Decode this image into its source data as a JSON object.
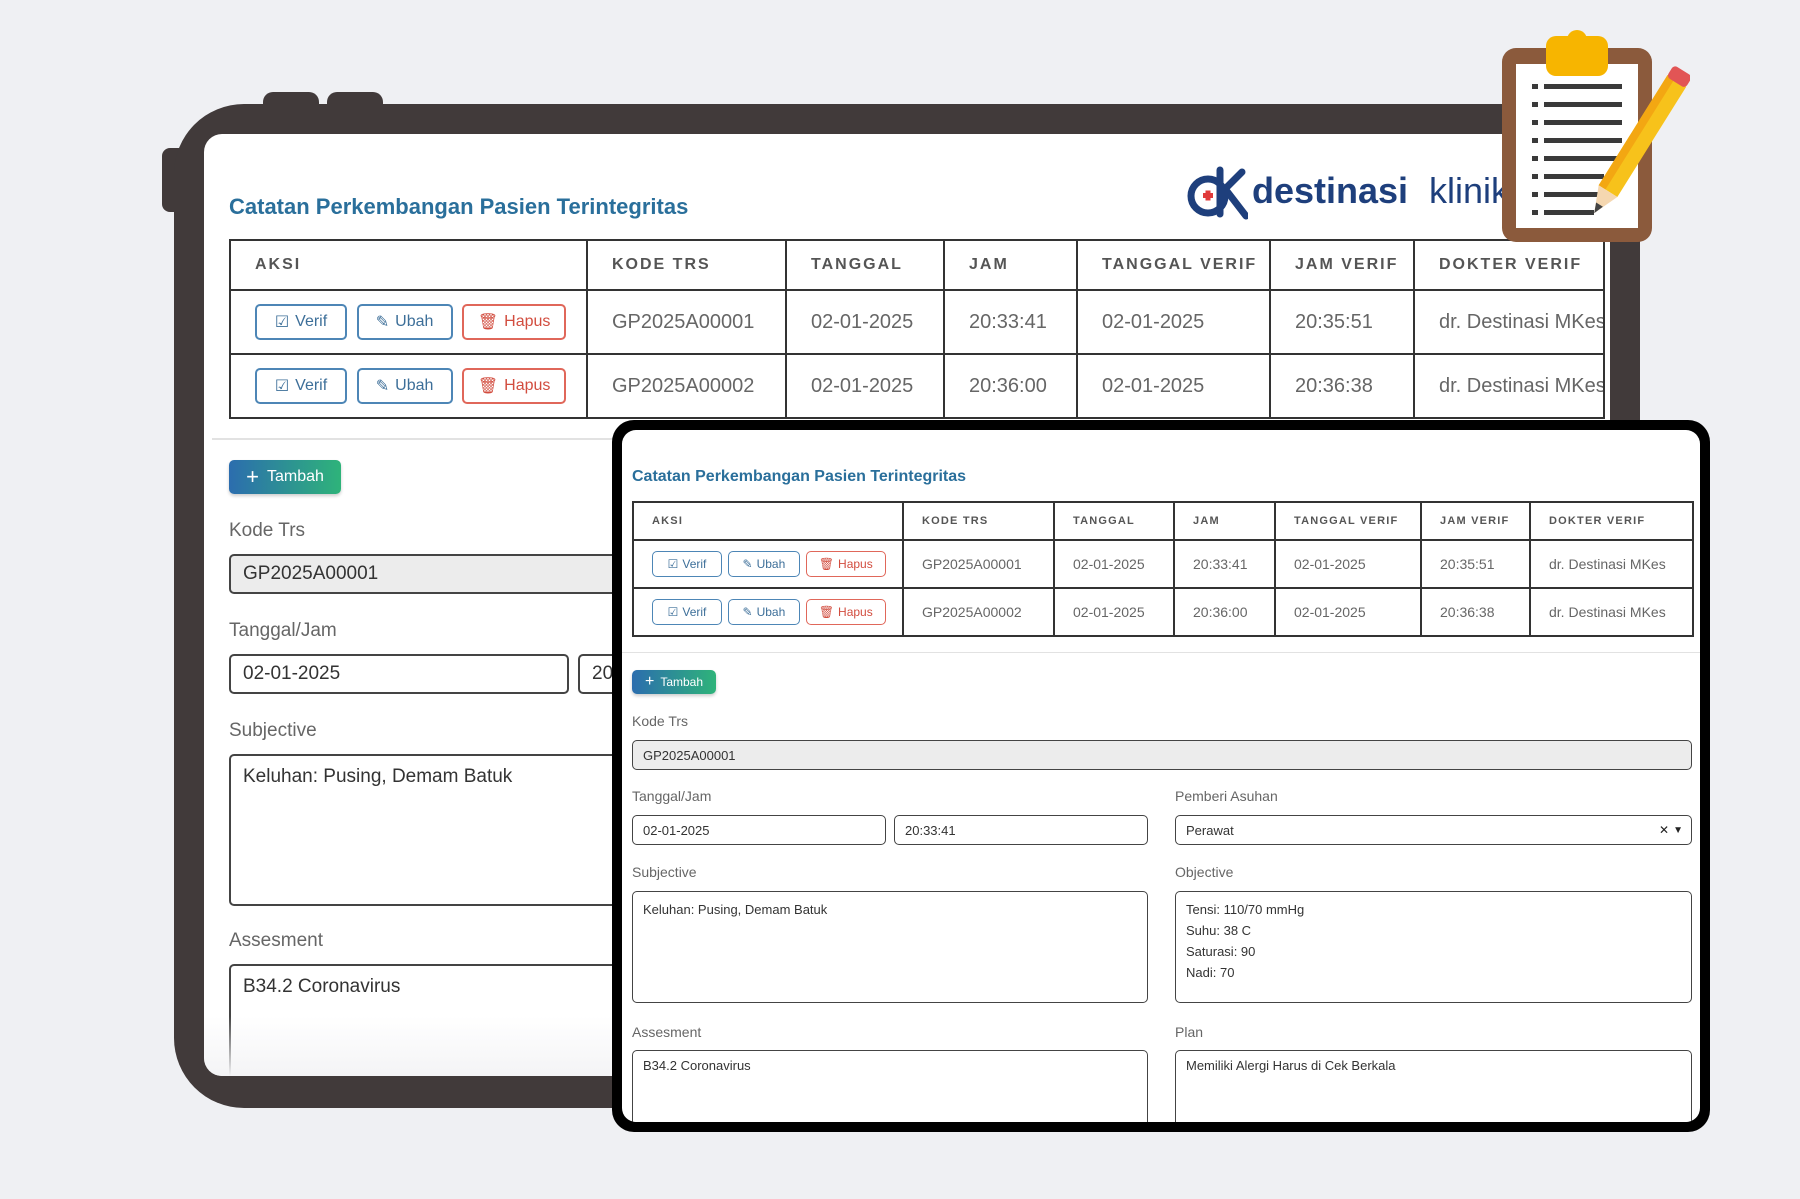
{
  "brand": {
    "name_a": "destinasi",
    "name_b": "klinik",
    "color_primary": "#1e3f7c",
    "color_cross": "#e03a3a"
  },
  "page_title": "Catatan Perkembangan Pasien Terintegritas",
  "table": {
    "headers": [
      "AKSI",
      "KODE TRS",
      "TANGGAL",
      "JAM",
      "TANGGAL VERIF",
      "JAM VERIF",
      "DOKTER VERIF"
    ],
    "rows": [
      {
        "kode": "GP2025A00001",
        "tanggal": "02-01-2025",
        "jam": "20:33:41",
        "tanggal_verif": "02-01-2025",
        "jam_verif": "20:35:51",
        "dokter": "dr. Destinasi MKes"
      },
      {
        "kode": "GP2025A00002",
        "tanggal": "02-01-2025",
        "jam": "20:36:00",
        "tanggal_verif": "02-01-2025",
        "jam_verif": "20:36:38",
        "dokter": "dr. Destinasi MKes"
      }
    ]
  },
  "actions": {
    "verif": "Verif",
    "ubah": "Ubah",
    "hapus": "Hapus"
  },
  "tambah_label": "Tambah",
  "form": {
    "kode_trs_label": "Kode Trs",
    "kode_trs_value": "GP2025A00001",
    "tanggal_jam_label": "Tanggal/Jam",
    "tanggal_value": "02-01-2025",
    "jam_value": "20:33:41",
    "jam_value_partial": "20",
    "pemberi_label": "Pemberi Asuhan",
    "pemberi_value": "Perawat",
    "subjective_label": "Subjective",
    "subjective_value": "Keluhan: Pusing, Demam Batuk",
    "objective_label": "Objective",
    "objective_value": "Tensi: 110/70 mmHg\nSuhu: 38 C\nSaturasi: 90\nNadi: 70",
    "assesment_label": "Assesment",
    "assesment_value": "B34.2 Coronavirus",
    "plan_label": "Plan",
    "plan_value": "Memiliki Alergi Harus di Cek Berkala"
  },
  "colors": {
    "title": "#2a6f9b",
    "frame": "#413a3a",
    "hapus": "#d24d3f",
    "verif": "#3d6f99"
  }
}
